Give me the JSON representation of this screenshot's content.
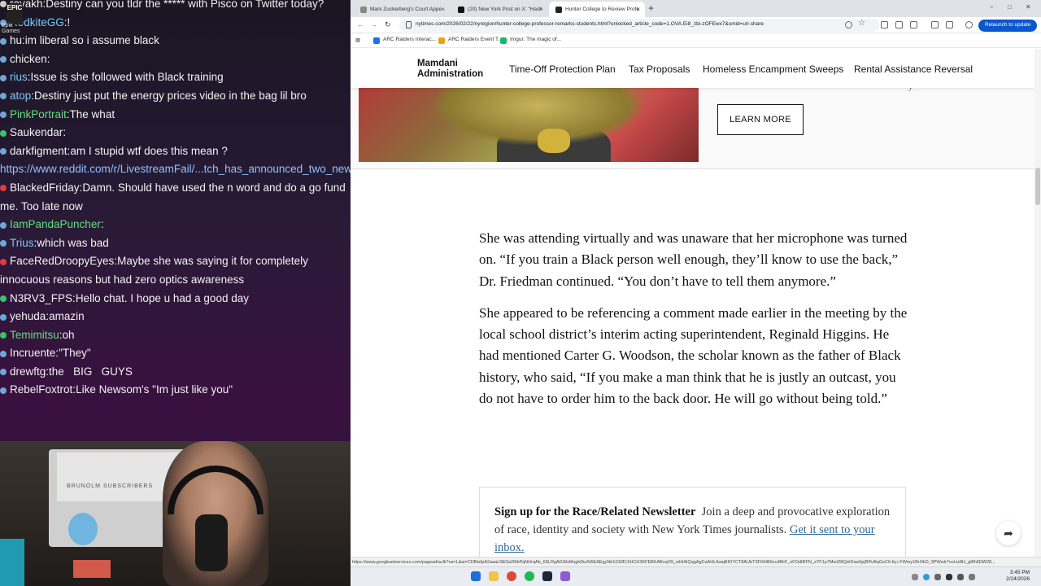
{
  "chat": {
    "logo_text": "EPIC",
    "logo_label": "Epic Games",
    "messages": [
      {
        "user": "ravakh",
        "text": "Destiny can you tldr the ***** with Pisco on Twitter today?",
        "user_color": "#f2f2f2",
        "badge": "#cccccc"
      },
      {
        "user": "RedkiteGG",
        "text": "!",
        "user_color": "#7cc8ff",
        "badge": "#6ea8d8"
      },
      {
        "user": "hu",
        "text": "im liberal so i assume black",
        "user_color": "#f2f2f2",
        "badge": "#6ea8d8"
      },
      {
        "user": "chicken",
        "text": "",
        "user_color": "#f2f2f2",
        "badge": "#6ea8d8"
      },
      {
        "user": "rius",
        "text": "Issue is she followed with Black training",
        "user_color": "#7cc8ff",
        "badge": "#6ea8d8"
      },
      {
        "user": "atop",
        "text": "Destiny just put the energy prices video in the bag lil bro",
        "user_color": "#7cc8ff",
        "badge": "#6ea8d8"
      },
      {
        "user": "PinkPortrait",
        "text": "The what",
        "user_color": "#5fe07a",
        "badge": "#6ea8d8"
      },
      {
        "user": "Saukendar",
        "text": "",
        "user_color": "#f2f2f2",
        "badge": "#39c46a"
      },
      {
        "user": "darkfigment",
        "text": "am I stupid wtf does this mean ?",
        "user_color": "#f2f2f2",
        "badge": "#6ea8d8"
      },
      {
        "user": "",
        "text": "",
        "link": "https://www.reddit.com/r/LivestreamFail/...tch_has_announced_two_new_types_of_bans/",
        "user_color": "#8fc1ff",
        "badge": ""
      },
      {
        "user": "BlackedFriday",
        "text": "Damn. Should have used the n word and do a go fund me. Too late now",
        "user_color": "#f2f2f2",
        "badge": "#e23b3b"
      },
      {
        "user": "IamPandaPuncher",
        "text": "",
        "user_color": "#5fe07a",
        "badge": "#6ea8d8"
      },
      {
        "user": "Trius",
        "text": "which was bad",
        "user_color": "#7cc8ff",
        "badge": "#6ea8d8"
      },
      {
        "user": "FaceRedDroopyEyes",
        "text": "Maybe she was saying it for completely innocuous reasons but had zero optics awareness",
        "user_color": "#f2f2f2",
        "badge": "#e23b3b"
      },
      {
        "user": "N3RV3_FPS",
        "text": "Hello chat. I hope u had a good day",
        "user_color": "#f2f2f2",
        "badge": "#39c46a"
      },
      {
        "user": "yehuda",
        "text": "amazin",
        "user_color": "#f2f2f2",
        "badge": "#6ea8d8"
      },
      {
        "user": "Temimitsu",
        "text": "oh",
        "user_color": "#5fe07a",
        "badge": "#39c46a"
      },
      {
        "user": "Incruente",
        "text": "\"They\"",
        "user_color": "#f2f2f2",
        "badge": "#6ea8d8"
      },
      {
        "user": "drewftg",
        "text": "the   BIG   GUYS",
        "user_color": "#f2f2f2",
        "badge": "#6ea8d8"
      },
      {
        "user": "RebelFoxtrot",
        "text": "Like Newsom's \"Im just like you\"",
        "user_color": "#f2f2f2",
        "badge": "#6ea8d8"
      }
    ]
  },
  "webcam": {
    "screen_text": "BRUNOLM  SUBSCRIBERS"
  },
  "browser": {
    "tabs": [
      {
        "title": "Mark Zuckerberg's Court Appe"
      },
      {
        "title": "(20) New York Post on X: \"Hash"
      },
      {
        "title": "Hunter College to Review Profe"
      }
    ],
    "new_tab": "+",
    "window_controls": {
      "minimize": "–",
      "maximize": "□",
      "close": "✕"
    },
    "nav": {
      "back": "←",
      "forward": "→",
      "reload": "↻"
    },
    "url": "nytimes.com/2026/02/22/nyregion/hunter-college-professor-remarks-students.html?unlocked_article_code=1.OVA.Ei8_zbi-zOFEwx7&smid=url-share",
    "relaunch_label": "Relaunch to update",
    "bookmarks": [
      {
        "label": "ARC Raiders Interac...",
        "color": "#1a73e8"
      },
      {
        "label": "ARC Raiders Event T...",
        "color": "#e8a21a"
      },
      {
        "label": "Imgur: The magic of...",
        "color": "#1bb76e"
      }
    ],
    "status_url": "https://www.googleadservices.com/pagead/aclk?sa=L&ai=CDBtzfpA2aaaLNE0a26tkPqNHrqAb_65LRgAGWsMsgh0kz5t5EAEgyNb1GWD;5HCH3KFEBKABvqO9_wIHAiQqgAgCaAHLAwqBIOYCT8AUbT3F044l0tccdBkF_nFOdtRFN_zYF1p7MwIZ8QdrDsw0pjRPuBqGsC6-fq-i-FWmy1BrOkD_9PWwlr7vnLtz8H_g9fh6DW28..."
  },
  "site": {
    "admin_title": "Mamdani Administration",
    "nav_links": [
      "Time-Off Protection Plan",
      "Tax Proposals",
      "Homeless Encampment Sweeps",
      "Rental Assistance Reversal"
    ],
    "promo_cta": "LEARN MORE",
    "promo_trailing": "y"
  },
  "article": {
    "paragraphs": [
      "She was attending virtually and was unaware that her microphone was turned on. “If you train a Black person well enough, they’ll know to use the back,” Dr. Friedman continued. “You don’t have to tell them anymore.”",
      "She appeared to be referencing a comment made earlier in the meeting by the local school district’s interim acting superintendent, Reginald Higgins. He had mentioned Carter G. Woodson, the scholar known as the father of Black history, who said, “If you make a man think that he is justly an outcast, you do not have to order him to the back door. He will go without being told.”"
    ]
  },
  "newsletter": {
    "title": "Sign up for the Race/Related Newsletter",
    "body": "Join a deep and provocative exploration of race, identity and society with New York Times journalists.",
    "link": "Get it sent to your inbox."
  },
  "taskbar": {
    "time": "3:45 PM",
    "date": "2/24/2026"
  }
}
